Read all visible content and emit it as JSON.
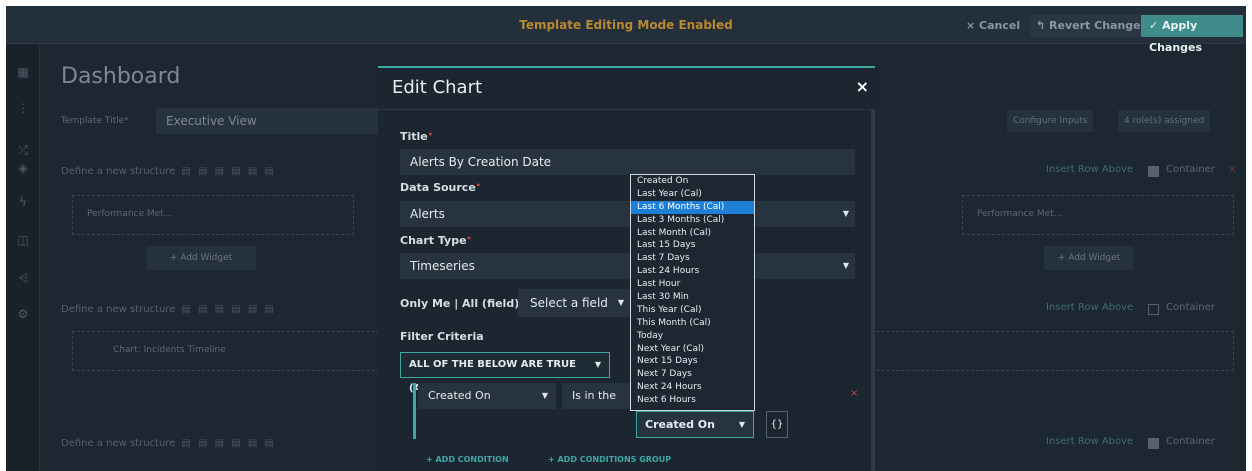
{
  "topbar": {
    "banner": "Template Editing Mode Enabled",
    "cancel": "× Cancel",
    "revert": "↰ Revert Changes",
    "apply": "✓ Apply Changes"
  },
  "dashboard": {
    "title": "Dashboard",
    "template_title_label": "Template Title*",
    "template_title_value": "Executive View",
    "structure_label": "Define a new structure",
    "widget_label": "Performance Met...",
    "add_widget": "+ Add Widget",
    "chart_label": "Chart: Incidents Timeline",
    "insert_row_above": "Insert Row Above",
    "container": "Container",
    "configure_inputs": "Configure Inputs",
    "roles_assigned": "4 role(s) assigned"
  },
  "modal": {
    "title": "Edit Chart",
    "close": "×",
    "title_label": "Title",
    "title_value": "Alerts By Creation Date",
    "data_source_label": "Data Source",
    "data_source_value": "Alerts",
    "chart_type_label": "Chart Type",
    "chart_type_value": "Timeseries",
    "only_me_label": "Only Me | All (field) :",
    "select_field": "Select a field",
    "filter_criteria_label": "Filter Criteria",
    "and_dropdown": "ALL OF THE BELOW ARE TRUE (AND)",
    "condition_field": "Created On",
    "condition_operator": "Is in the",
    "condition_value": "Created On",
    "braces": "{}",
    "add_condition": "+ ADD CONDITION",
    "add_conditions_group": "+ ADD CONDITIONS GROUP"
  },
  "dropdown": {
    "selected_index": 2,
    "options": [
      "Created On",
      "Last Year (Cal)",
      "Last 6 Months (Cal)",
      "Last 3 Months (Cal)",
      "Last Month (Cal)",
      "Last 15 Days",
      "Last 7 Days",
      "Last 24 Hours",
      "Last Hour",
      "Last 30 Min",
      "This Year (Cal)",
      "This Month (Cal)",
      "Today",
      "Next Year (Cal)",
      "Next 15 Days",
      "Next 7 Days",
      "Next 24 Hours",
      "Next 6 Hours"
    ]
  }
}
